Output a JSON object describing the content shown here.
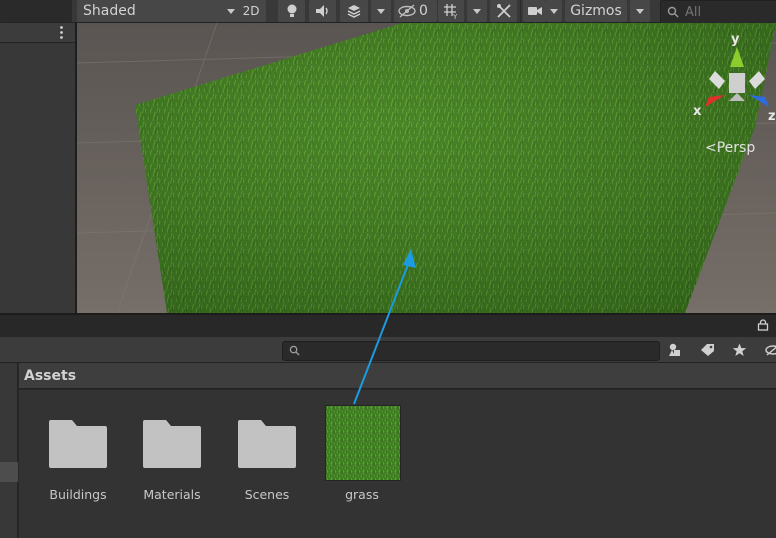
{
  "toolbar": {
    "shading_mode": "Shaded",
    "view_2d_label": "2D",
    "hidden_count": "0",
    "gizmos_label": "Gizmos",
    "search_placeholder": "All"
  },
  "scene": {
    "projection_label": "Persp",
    "axis_labels": {
      "x": "x",
      "y": "y",
      "z": "z"
    },
    "axis_colors": {
      "x": "#e0302a",
      "y": "#8ccc2c",
      "z": "#2f6be0"
    }
  },
  "project": {
    "breadcrumb": "Assets",
    "search_value": "",
    "assets": [
      {
        "label": "Buildings",
        "icon": "folder-icon"
      },
      {
        "label": "Materials",
        "icon": "folder-icon"
      },
      {
        "label": "Scenes",
        "icon": "folder-icon"
      },
      {
        "label": "grass",
        "icon": "grass-texture-thumbnail"
      }
    ]
  },
  "annotation": {
    "arrow_color": "#1c9be0"
  }
}
